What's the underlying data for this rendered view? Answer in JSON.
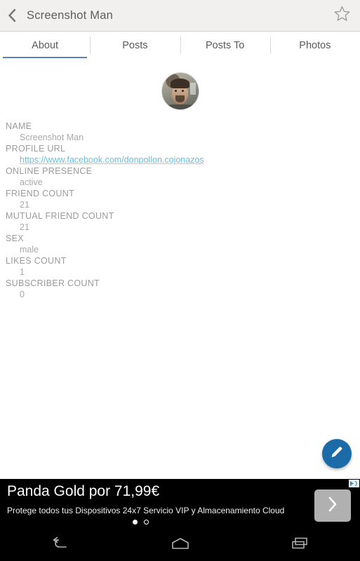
{
  "actionbar": {
    "back_icon": "chevron-left-icon",
    "title": "Screenshot Man",
    "star_icon": "star-outline-icon"
  },
  "tabs": [
    {
      "label": "About",
      "active": true
    },
    {
      "label": "Posts",
      "active": false
    },
    {
      "label": "Posts To",
      "active": false
    },
    {
      "label": "Photos",
      "active": false
    }
  ],
  "profile": {
    "avatar_alt": "profile-photo",
    "fields": [
      {
        "label": "NAME",
        "value": "Screenshot Man",
        "is_link": false
      },
      {
        "label": "PROFILE URL",
        "value": "https://www.facebook.com/donpollon.cojonazos",
        "is_link": true
      },
      {
        "label": "ONLINE PRESENCE",
        "value": "active",
        "is_link": false
      },
      {
        "label": "FRIEND COUNT",
        "value": "21",
        "is_link": false
      },
      {
        "label": "MUTUAL FRIEND COUNT",
        "value": "21",
        "is_link": false
      },
      {
        "label": "SEX",
        "value": "male",
        "is_link": false
      },
      {
        "label": "LIKES COUNT",
        "value": "1",
        "is_link": false
      },
      {
        "label": "SUBSCRIBER COUNT",
        "value": "0",
        "is_link": false
      }
    ]
  },
  "fab": {
    "icon": "pencil-edit-icon",
    "color": "#1b6ba8"
  },
  "ad": {
    "headline": "Panda Gold por 71,99€",
    "subtitle": "Protege todos tus Dispositivos 24x7 Servicio VIP y Almacenamiento Cloud",
    "cta_icon": "chevron-right-icon",
    "adchoices_icon": "adchoices-icon",
    "dots": [
      {
        "state": "filled"
      },
      {
        "state": "hollow"
      }
    ]
  },
  "navbar": {
    "back_icon": "nav-back-icon",
    "home_icon": "nav-home-icon",
    "recents_icon": "nav-recents-icon"
  },
  "colors": {
    "accent_tab": "#5a7fb5",
    "link": "#62c3e2",
    "fab": "#1b6ba8",
    "actionbar_bg": "#f1f0ef"
  }
}
